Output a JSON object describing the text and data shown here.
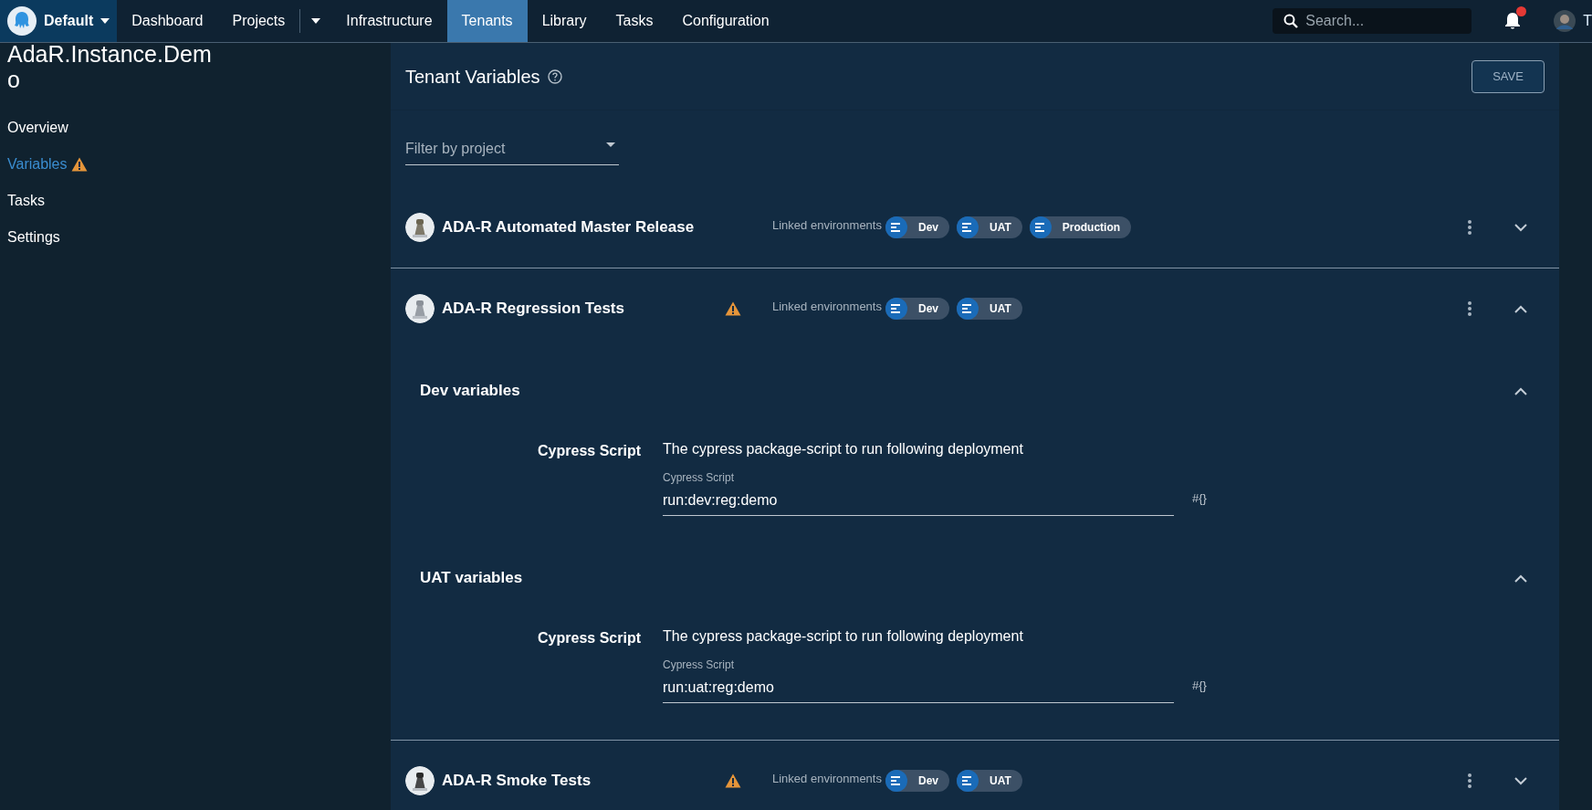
{
  "nav": {
    "brand": "Default",
    "items": [
      {
        "label": "Dashboard",
        "selected": false,
        "dropdown": false
      },
      {
        "label": "Projects",
        "selected": false,
        "dropdown": true
      },
      {
        "label": "Infrastructure",
        "selected": false,
        "dropdown": false
      },
      {
        "label": "Tenants",
        "selected": true,
        "dropdown": false
      },
      {
        "label": "Library",
        "selected": false,
        "dropdown": false
      },
      {
        "label": "Tasks",
        "selected": false,
        "dropdown": false
      },
      {
        "label": "Configuration",
        "selected": false,
        "dropdown": false
      }
    ],
    "search": {
      "placeholder": "Search..."
    },
    "notifications": {
      "unread": true
    },
    "user": {
      "initial": "T"
    }
  },
  "sidebar": {
    "title": "AdaR.Instance.Demo",
    "items": [
      {
        "label": "Overview",
        "selected": false,
        "warning": false
      },
      {
        "label": "Variables",
        "selected": true,
        "warning": true
      },
      {
        "label": "Tasks",
        "selected": false,
        "warning": false
      },
      {
        "label": "Settings",
        "selected": false,
        "warning": false
      }
    ]
  },
  "main": {
    "title": "Tenant Variables",
    "save": "SAVE",
    "filter": {
      "placeholder": "Filter by project"
    },
    "projects": [
      {
        "name": "ADA-R Automated Master Release",
        "warning": false,
        "expanded": false,
        "linked_label": "Linked environments",
        "environments": [
          "Dev",
          "UAT",
          "Production"
        ]
      },
      {
        "name": "ADA-R Regression Tests",
        "warning": true,
        "expanded": true,
        "linked_label": "Linked environments",
        "environments": [
          "Dev",
          "UAT"
        ],
        "groups": [
          {
            "title": "Dev variables",
            "expanded": true,
            "variables": [
              {
                "name": "Cypress Script",
                "description": "The cypress package-script to run following deployment",
                "field_label": "Cypress Script",
                "value": "run:dev:reg:demo",
                "binding": "#{}"
              }
            ]
          },
          {
            "title": "UAT variables",
            "expanded": true,
            "variables": [
              {
                "name": "Cypress Script",
                "description": "The cypress package-script to run following deployment",
                "field_label": "Cypress Script",
                "value": "run:uat:reg:demo",
                "binding": "#{}"
              }
            ]
          }
        ]
      },
      {
        "name": "ADA-R Smoke Tests",
        "warning": true,
        "expanded": false,
        "linked_label": "Linked environments",
        "environments": [
          "Dev",
          "UAT"
        ]
      }
    ]
  }
}
